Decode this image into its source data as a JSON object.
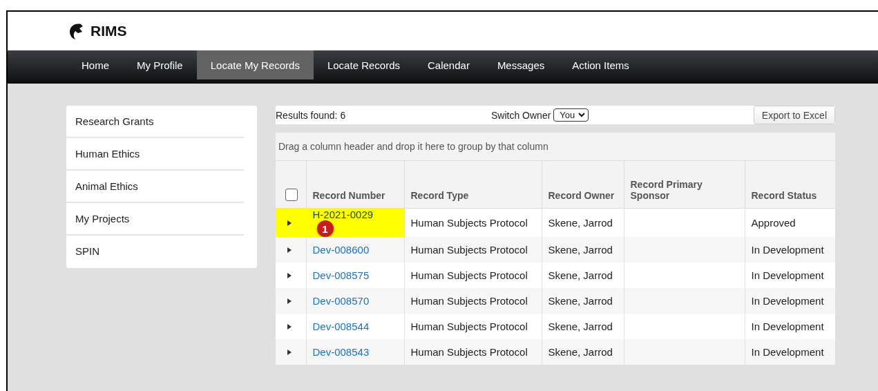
{
  "header": {
    "logo_text": "RIMS"
  },
  "nav": [
    {
      "label": "Home",
      "selected": false
    },
    {
      "label": "My Profile",
      "selected": false
    },
    {
      "label": "Locate My Records",
      "selected": true
    },
    {
      "label": "Locate Records",
      "selected": false
    },
    {
      "label": "Calendar",
      "selected": false
    },
    {
      "label": "Messages",
      "selected": false
    },
    {
      "label": "Action Items",
      "selected": false
    }
  ],
  "sidebar": {
    "items": [
      "Research Grants",
      "Human Ethics",
      "Animal Ethics",
      "My Projects",
      "SPIN"
    ]
  },
  "toolbar": {
    "results": "Results found: 6",
    "switch_owner_label": "Switch Owner",
    "switch_owner_value": "You",
    "export_button": "Export to Excel"
  },
  "group_hint": "Drag a column header and drop it here to group by that column",
  "table": {
    "select_all_checked": false,
    "columns": [
      "Record Number",
      "Record Type",
      "Record Owner",
      "Record Primary Sponsor",
      "Record Status"
    ],
    "rows": [
      {
        "highlighted": true,
        "cells": [
          "H-2021-0029",
          "Human Subjects Protocol",
          "Skene, Jarrod",
          "",
          "Approved"
        ]
      },
      {
        "highlighted": false,
        "cells": [
          "Dev-008600",
          "Human Subjects Protocol",
          "Skene, Jarrod",
          "",
          "In Development"
        ]
      },
      {
        "highlighted": false,
        "cells": [
          "Dev-008575",
          "Human Subjects Protocol",
          "Skene, Jarrod",
          "",
          "In Development"
        ]
      },
      {
        "highlighted": false,
        "cells": [
          "Dev-008570",
          "Human Subjects Protocol",
          "Skene, Jarrod",
          "",
          "In Development"
        ]
      },
      {
        "highlighted": false,
        "cells": [
          "Dev-008544",
          "Human Subjects Protocol",
          "Skene, Jarrod",
          "",
          "In Development"
        ]
      },
      {
        "highlighted": false,
        "cells": [
          "Dev-008543",
          "Human Subjects Protocol",
          "Skene, Jarrod",
          "",
          "In Development"
        ]
      }
    ]
  },
  "callout": {
    "label": "1"
  }
}
